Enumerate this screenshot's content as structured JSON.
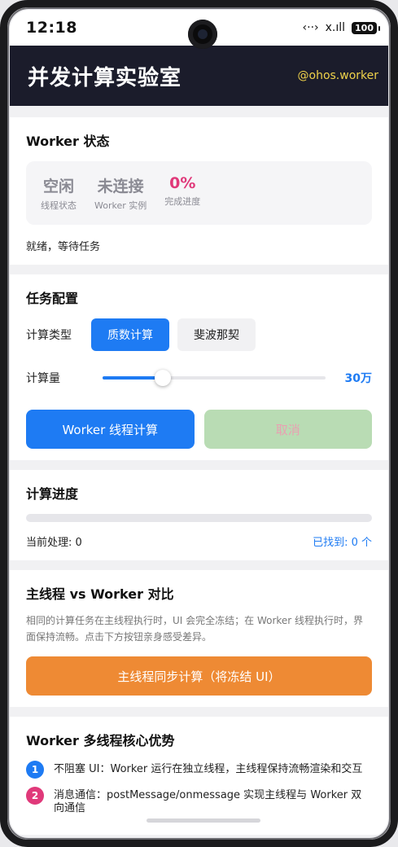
{
  "statusbar": {
    "time": "12:18",
    "icons": [
      "nfc-icon",
      "signal-icon"
    ],
    "signal_text": "x.ıll",
    "nfc_text": "‹··›",
    "battery": "100"
  },
  "header": {
    "title": "并发计算实验室",
    "subtitle": "@ohos.worker"
  },
  "worker_status": {
    "title": "Worker 状态",
    "stats": [
      {
        "value": "空闲",
        "label": "线程状态"
      },
      {
        "value": "未连接",
        "label": "Worker 实例"
      },
      {
        "value": "0%",
        "label": "完成进度"
      }
    ],
    "message": "就绪，等待任务",
    "progress_color": "#e0397a"
  },
  "task_config": {
    "title": "任务配置",
    "type_label": "计算类型",
    "types": [
      "质数计算",
      "斐波那契"
    ],
    "selected_type": "质数计算",
    "amount_label": "计算量",
    "amount_value": "30万",
    "slider_fraction": 0.27,
    "run_button": "Worker 线程计算",
    "cancel_button": "取消"
  },
  "progress": {
    "title": "计算进度",
    "fraction": 0,
    "current_label": "当前处理: 0",
    "found_label": "已找到: 0 个"
  },
  "compare": {
    "title": "主线程 vs Worker 对比",
    "description": "相同的计算任务在主线程执行时，UI 会完全冻结；在 Worker 线程执行时，界面保持流畅。点击下方按钮亲身感受差异。",
    "button": "主线程同步计算（将冻结 UI）"
  },
  "advantages": {
    "title": "Worker 多线程核心优势",
    "items": [
      {
        "num": "1",
        "text": "不阻塞 UI：Worker 运行在独立线程，主线程保持流畅渲染和交互"
      },
      {
        "num": "2",
        "text": "消息通信：postMessage/onmessage 实现主线程与 Worker 双向通信"
      }
    ]
  },
  "colors": {
    "accent": "#1e7bf3",
    "header_bg": "#1b1c2b",
    "header_sub": "#f0d24a",
    "orange": "#ee8a34",
    "pink": "#e0397a"
  }
}
